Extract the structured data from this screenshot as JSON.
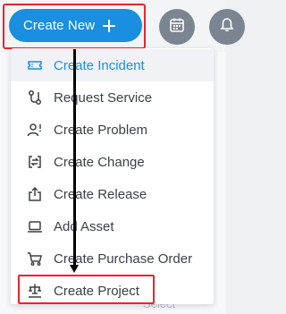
{
  "header": {
    "create_new_label": "Create New",
    "calendar_icon": "calendar-icon",
    "bell_icon": "bell-icon"
  },
  "menu": {
    "items": [
      {
        "label": "Create Incident",
        "icon": "ticket-icon",
        "active": true
      },
      {
        "label": "Request Service",
        "icon": "service-request-icon",
        "active": false
      },
      {
        "label": "Create Problem",
        "icon": "problem-icon",
        "active": false
      },
      {
        "label": "Create Change",
        "icon": "change-icon",
        "active": false
      },
      {
        "label": "Create Release",
        "icon": "release-icon",
        "active": false
      },
      {
        "label": "Add Asset",
        "icon": "laptop-icon",
        "active": false
      },
      {
        "label": "Create Purchase Order",
        "icon": "cart-icon",
        "active": false
      },
      {
        "label": "Create Project",
        "icon": "project-icon",
        "active": false
      }
    ]
  },
  "background": {
    "select_placeholder": "Select"
  },
  "colors": {
    "primary": "#1a8fe0",
    "highlight": "#e4262f",
    "text": "#3a3f47",
    "icon_gray": "#7b8591"
  }
}
